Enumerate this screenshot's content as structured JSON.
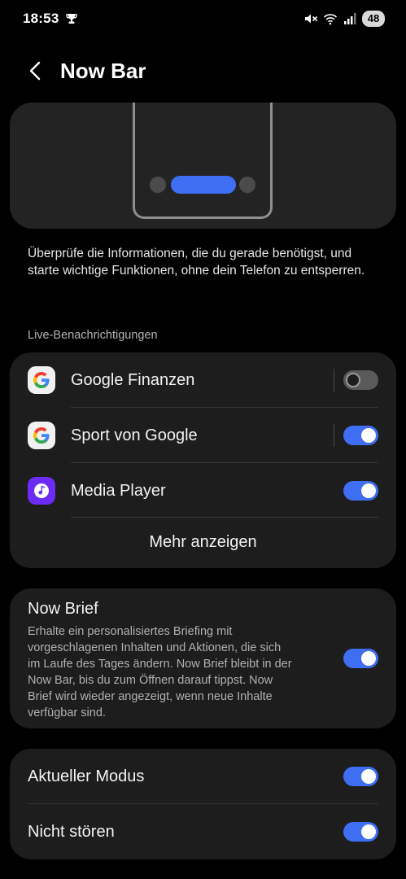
{
  "status_bar": {
    "time": "18:53",
    "battery": "48",
    "icons": [
      "trophy-icon",
      "mute-icon",
      "wifi-icon",
      "signal-icon"
    ]
  },
  "header": {
    "title": "Now Bar",
    "back_icon": "chevron-left-icon"
  },
  "colors": {
    "accent": "#3e6ef2",
    "card": "#1d1d1d",
    "background": "#000000"
  },
  "description": "Überprüfe die Informationen, die du gerade benötigst, und starte wichtige Funktionen, ohne dein Telefon zu entsperren.",
  "live_section": {
    "label": "Live-Benachrichtigungen",
    "items": [
      {
        "label": "Google Finanzen",
        "icon": "google-icon",
        "enabled": false
      },
      {
        "label": "Sport von Google",
        "icon": "google-icon",
        "enabled": true
      },
      {
        "label": "Media Player",
        "icon": "music-note-icon",
        "enabled": true
      }
    ],
    "more_label": "Mehr anzeigen"
  },
  "now_brief": {
    "title": "Now Brief",
    "description": "Erhalte ein personalisiertes Briefing mit vorgeschlagenen Inhalten und Aktionen, die sich im Laufe des Tages ändern. Now Brief bleibt in der Now Bar, bis du zum Öffnen darauf tippst. Now Brief wird wieder angezeigt, wenn neue Inhalte verfügbar sind.",
    "enabled": true
  },
  "modes": {
    "items": [
      {
        "label": "Aktueller Modus",
        "enabled": true
      },
      {
        "label": "Nicht stören",
        "enabled": true
      }
    ]
  }
}
